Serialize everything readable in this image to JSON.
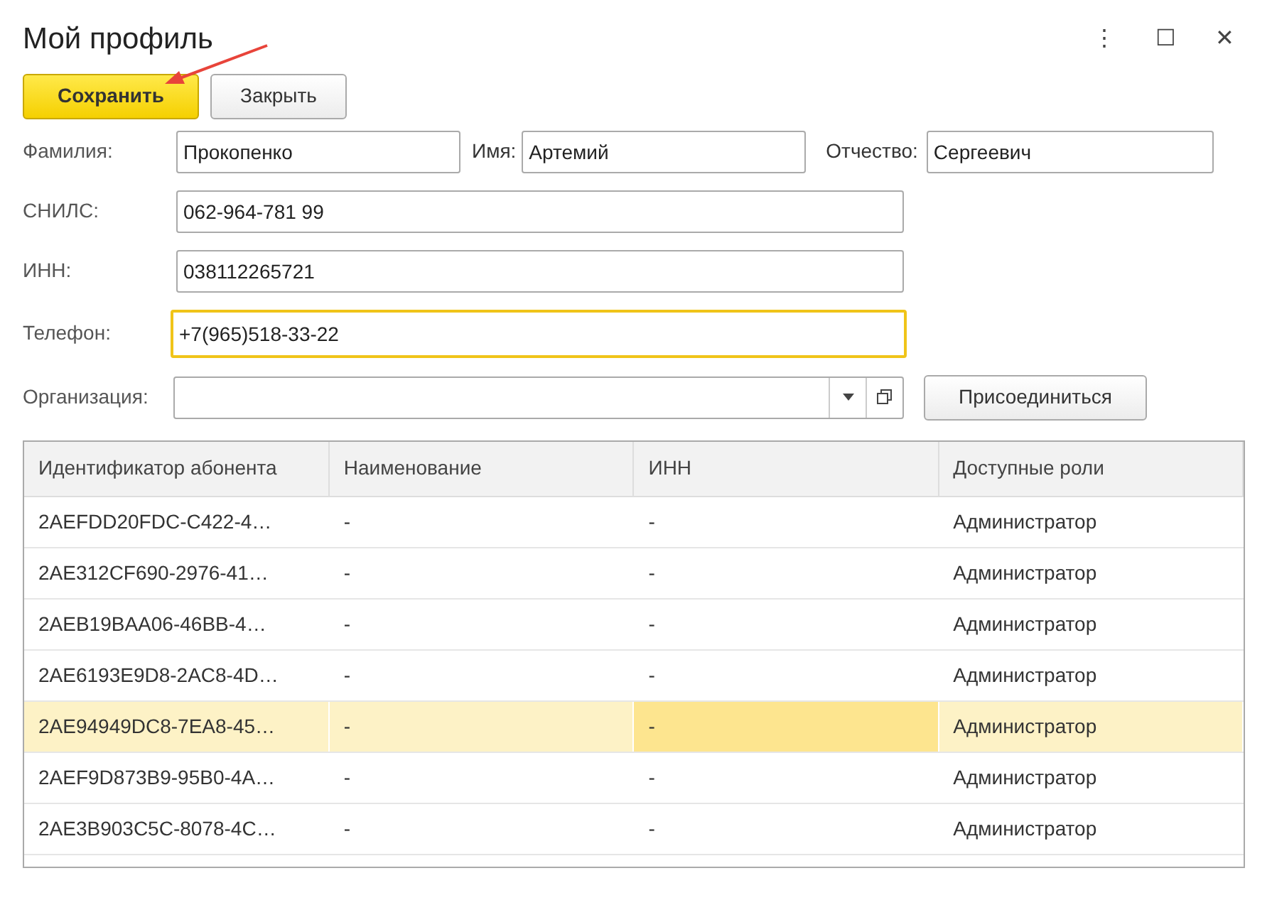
{
  "window": {
    "title": "Мой профиль",
    "controls": [
      "⋮",
      "☐",
      "✕"
    ]
  },
  "buttons": [
    {
      "label": "Сохранить",
      "kind": "primary"
    },
    {
      "label": "Закрыть",
      "kind": "default"
    }
  ],
  "annotation": {
    "kind": "arrow"
  },
  "name_row": [
    {
      "label": "Фамилия:",
      "value": "Прокопенко",
      "focused": false
    },
    {
      "label": "Имя:",
      "value": "Артемий",
      "focused": false
    },
    {
      "label": "Отчество:",
      "value": "Сергеевич",
      "focused": false
    }
  ],
  "fields": [
    {
      "label": "СНИЛС:",
      "value": "062-964-781 99",
      "focused": false,
      "kind": "text"
    },
    {
      "label": "ИНН:",
      "value": "038112265721",
      "focused": false,
      "kind": "text"
    },
    {
      "label": "Телефон:",
      "value": "+7(965)518-33-22",
      "focused": true,
      "kind": "text"
    },
    {
      "label": "Организация:",
      "focused": false,
      "kind": "select",
      "action": "Присоединиться"
    }
  ],
  "table": {
    "columns": [
      "Идентификатор абонента",
      "Наименование",
      "ИНН",
      "Доступные роли"
    ],
    "rows": [
      {
        "selected": false,
        "cells": [
          {
            "text": "2AEFDD20FDC-C422-4…",
            "current": false
          },
          {
            "text": "-",
            "current": false
          },
          {
            "text": "-",
            "current": false
          },
          {
            "text": "Администратор",
            "current": false
          }
        ]
      },
      {
        "selected": false,
        "cells": [
          {
            "text": "2AE312CF690-2976-41…",
            "current": false
          },
          {
            "text": "-",
            "current": false
          },
          {
            "text": "-",
            "current": false
          },
          {
            "text": "Администратор",
            "current": false
          }
        ]
      },
      {
        "selected": false,
        "cells": [
          {
            "text": "2AEB19BAA06-46BB-4…",
            "current": false
          },
          {
            "text": "-",
            "current": false
          },
          {
            "text": "-",
            "current": false
          },
          {
            "text": "Администратор",
            "current": false
          }
        ]
      },
      {
        "selected": false,
        "cells": [
          {
            "text": "2AE6193E9D8-2AC8-4D…",
            "current": false
          },
          {
            "text": "-",
            "current": false
          },
          {
            "text": "-",
            "current": false
          },
          {
            "text": "Администратор",
            "current": false
          }
        ]
      },
      {
        "selected": true,
        "cells": [
          {
            "text": "2AE94949DC8-7EA8-45…",
            "current": false
          },
          {
            "text": "-",
            "current": false
          },
          {
            "text": "-",
            "current": true
          },
          {
            "text": "Администратор",
            "current": false
          }
        ]
      },
      {
        "selected": false,
        "cells": [
          {
            "text": "2AEF9D873B9-95B0-4A…",
            "current": false
          },
          {
            "text": "-",
            "current": false
          },
          {
            "text": "-",
            "current": false
          },
          {
            "text": "Администратор",
            "current": false
          }
        ]
      },
      {
        "selected": false,
        "cells": [
          {
            "text": "2AE3B903C5C-8078-4C…",
            "current": false
          },
          {
            "text": "-",
            "current": false
          },
          {
            "text": "-",
            "current": false
          },
          {
            "text": "Администратор",
            "current": false
          }
        ]
      }
    ]
  }
}
